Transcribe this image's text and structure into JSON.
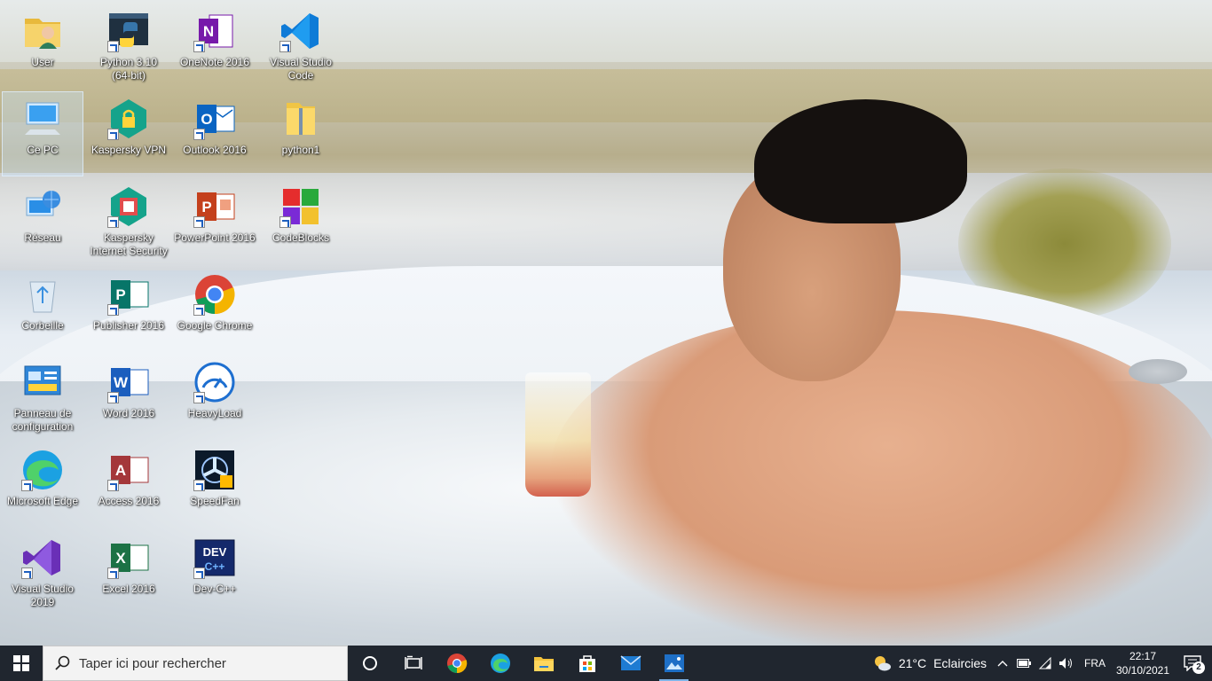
{
  "desktop": {
    "icons": [
      {
        "label": "User",
        "icon": "user-folder-icon",
        "shortcut": false
      },
      {
        "label": "Python 3.10\n(64-bit)",
        "icon": "python-icon",
        "shortcut": true
      },
      {
        "label": "OneNote 2016",
        "icon": "onenote-icon",
        "shortcut": true
      },
      {
        "label": "Visual Studio\nCode",
        "icon": "vscode-icon",
        "shortcut": true
      },
      {
        "label": "Ce PC",
        "icon": "this-pc-icon",
        "shortcut": false
      },
      {
        "label": "Kaspersky VPN",
        "icon": "kaspersky-vpn-icon",
        "shortcut": true
      },
      {
        "label": "Outlook 2016",
        "icon": "outlook-icon",
        "shortcut": true
      },
      {
        "label": "python1",
        "icon": "zip-folder-icon",
        "shortcut": false
      },
      {
        "label": "Réseau",
        "icon": "network-icon",
        "shortcut": false
      },
      {
        "label": "Kaspersky\nInternet Security",
        "icon": "kaspersky-is-icon",
        "shortcut": true
      },
      {
        "label": "PowerPoint 2016",
        "icon": "powerpoint-icon",
        "shortcut": true
      },
      {
        "label": "CodeBlocks",
        "icon": "codeblocks-icon",
        "shortcut": true
      },
      {
        "label": "Corbeille",
        "icon": "recycle-bin-icon",
        "shortcut": false
      },
      {
        "label": "Publisher 2016",
        "icon": "publisher-icon",
        "shortcut": true
      },
      {
        "label": "Google Chrome",
        "icon": "chrome-icon",
        "shortcut": true
      },
      {
        "label": "Panneau de\nconfiguration",
        "icon": "control-panel-icon",
        "shortcut": false
      },
      {
        "label": "Word 2016",
        "icon": "word-icon",
        "shortcut": true
      },
      {
        "label": "HeavyLoad",
        "icon": "heavyload-icon",
        "shortcut": true
      },
      {
        "label": "Microsoft Edge",
        "icon": "edge-icon",
        "shortcut": true
      },
      {
        "label": "Access 2016",
        "icon": "access-icon",
        "shortcut": true
      },
      {
        "label": "SpeedFan",
        "icon": "speedfan-icon",
        "shortcut": true
      },
      {
        "label": "Visual Studio\n2019",
        "icon": "visual-studio-icon",
        "shortcut": true
      },
      {
        "label": "Excel 2016",
        "icon": "excel-icon",
        "shortcut": true
      },
      {
        "label": "Dev-C++",
        "icon": "devcpp-icon",
        "shortcut": true
      }
    ],
    "selected": "Ce PC"
  },
  "taskbar": {
    "search_placeholder": "Taper ici pour rechercher",
    "pinned": [
      "cortana-icon",
      "task-view-icon",
      "chrome-icon",
      "edge-icon",
      "file-explorer-icon",
      "store-icon",
      "mail-icon",
      "photos-icon"
    ],
    "active": "photos-icon",
    "weather": {
      "temp": "21°C",
      "condition": "Eclaircies"
    },
    "language": "FRA",
    "time": "22:17",
    "date": "30/10/2021",
    "notifications": "2"
  },
  "colors": {
    "taskbar_bg": "#20262f",
    "accent": "#7fb4e8"
  }
}
